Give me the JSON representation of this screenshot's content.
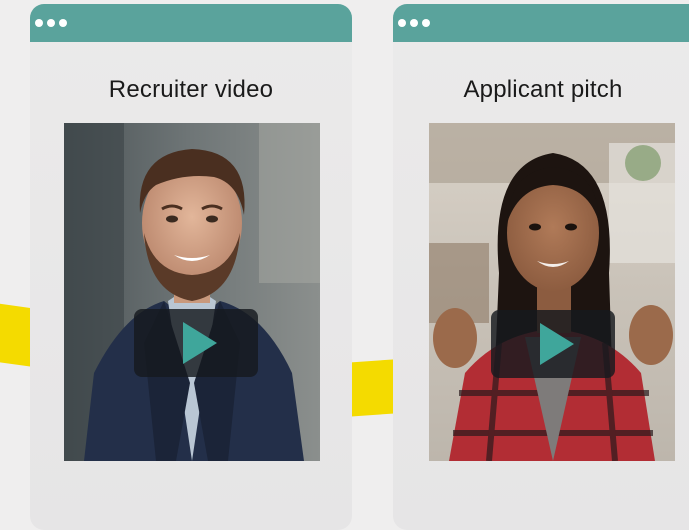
{
  "cards": [
    {
      "title": "Recruiter video",
      "media": "photo of smiling bearded man in navy blazer",
      "play_icon": "play-icon"
    },
    {
      "title": "Applicant pitch",
      "media": "photo of smiling young woman in red plaid shirt",
      "play_icon": "play-icon"
    }
  ],
  "colors": {
    "titlebar": "#5aa39c",
    "card_bg": "#ebeaea",
    "page_bg": "#efeeee",
    "accent_yellow": "#f4db00",
    "play_triangle": "#3fa69b",
    "play_bg": "#161a1e"
  },
  "window_controls": [
    "dot-icon",
    "dot-icon",
    "dot-icon"
  ]
}
